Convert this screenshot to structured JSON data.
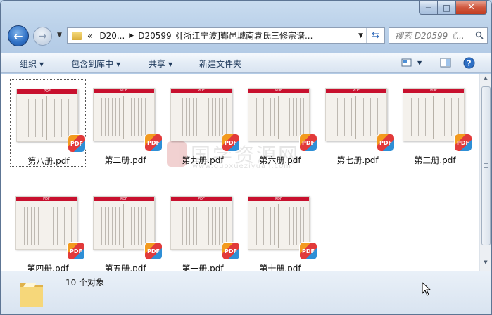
{
  "window": {
    "caption": {
      "minimize": "−",
      "maximize": "□",
      "close": "✕"
    }
  },
  "nav": {
    "back_icon": "back-arrow-icon",
    "forward_icon": "forward-arrow-icon",
    "address_parts": [
      "«",
      "D20...",
      "D20599《[浙江宁波]鄞邑城南袁氏三修宗谱..."
    ],
    "search_placeholder": "搜索 D20599《..."
  },
  "toolbar": {
    "organize": "组织",
    "include_in_library": "包含到库中",
    "share": "共享",
    "new_folder": "新建文件夹"
  },
  "files": [
    {
      "name": "第八册.pdf",
      "selected": true
    },
    {
      "name": "第二册.pdf"
    },
    {
      "name": "第九册.pdf"
    },
    {
      "name": "第六册.pdf"
    },
    {
      "name": "第七册.pdf"
    },
    {
      "name": "第三册.pdf"
    },
    {
      "name": "第四册.pdf"
    },
    {
      "name": "第五册.pdf"
    },
    {
      "name": "第一册.pdf"
    },
    {
      "name": "第十册.pdf"
    }
  ],
  "thumb_header": "PDF",
  "badge_text": "PDF",
  "watermark": {
    "text": "国学资源网",
    "url": "www.guoxueziyuan.com"
  },
  "status": {
    "count_text": "10 个对象"
  },
  "colors": {
    "accent": "#2e6fc4",
    "pdf_red": "#c8102e"
  }
}
